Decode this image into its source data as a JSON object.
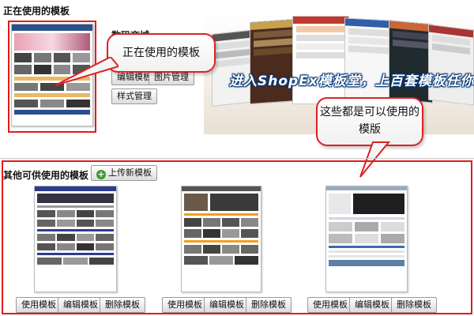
{
  "current": {
    "section_title": "正在使用的模板",
    "template_name_label": "数码商城",
    "edit_template_label": "编辑模板",
    "image_manage_label": "图片管理",
    "style_manage_label": "样式管理",
    "callout_text": "正在使用的模板"
  },
  "banner": {
    "headline": "进入ShopEx模板堂，上百套模板任你"
  },
  "other": {
    "section_title": "其他可供使用的模板",
    "upload_label": "上传新模板",
    "callout_text": "这些都是可以使用的模版",
    "templates": [
      {
        "use_label": "使用模板",
        "edit_label": "编辑模板",
        "delete_label": "删除模板"
      },
      {
        "use_label": "使用模板",
        "edit_label": "编辑模板",
        "delete_label": "删除模板"
      },
      {
        "use_label": "使用模板",
        "edit_label": "编辑模板",
        "delete_label": "删除模板"
      }
    ]
  },
  "colors": {
    "annotation_red": "#e11b1b",
    "banner_text_outline": "#0a3a78",
    "upload_icon_green": "#3a9b2c"
  },
  "icons": [
    "plus-circle-icon"
  ]
}
